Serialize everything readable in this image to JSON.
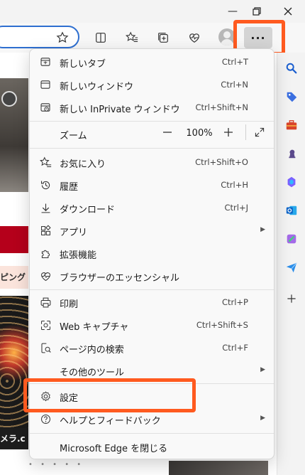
{
  "window": {
    "minimize_glyph": "—",
    "restore_glyph": "❐",
    "close_glyph": "✕"
  },
  "toolbar": {
    "more_label": "···"
  },
  "page": {
    "band_text": "ピング",
    "camera_text": "メラ.c",
    "dots": "• • • • •"
  },
  "menu": {
    "items": [
      {
        "label": "新しいタブ",
        "shortcut": "Ctrl+T",
        "icon": "new-tab-icon"
      },
      {
        "label": "新しいウィンドウ",
        "shortcut": "Ctrl+N",
        "icon": "new-window-icon"
      },
      {
        "label": "新しい InPrivate ウィンドウ",
        "shortcut": "Ctrl+Shift+N",
        "icon": "inprivate-icon"
      }
    ],
    "zoom": {
      "label": "ズーム",
      "minus": "—",
      "value": "100%",
      "plus": "+"
    },
    "items2": [
      {
        "label": "お気に入り",
        "shortcut": "Ctrl+Shift+O",
        "icon": "favorites-icon"
      },
      {
        "label": "履歴",
        "shortcut": "Ctrl+H",
        "icon": "history-icon"
      },
      {
        "label": "ダウンロード",
        "shortcut": "Ctrl+J",
        "icon": "download-icon"
      },
      {
        "label": "アプリ",
        "shortcut": "",
        "icon": "apps-icon"
      },
      {
        "label": "拡張機能",
        "shortcut": "",
        "icon": "extensions-icon"
      },
      {
        "label": "ブラウザーのエッセンシャル",
        "shortcut": "",
        "icon": "heart-pulse-icon"
      }
    ],
    "items3": [
      {
        "label": "印刷",
        "shortcut": "Ctrl+P",
        "icon": "print-icon"
      },
      {
        "label": "Web キャプチャ",
        "shortcut": "Ctrl+Shift+S",
        "icon": "web-capture-icon"
      },
      {
        "label": "ページ内の検索",
        "shortcut": "Ctrl+F",
        "icon": "find-icon"
      },
      {
        "label": "その他のツール",
        "shortcut": "",
        "icon": ""
      }
    ],
    "items4": [
      {
        "label": "設定",
        "shortcut": "",
        "icon": "settings-icon"
      },
      {
        "label": "ヘルプとフィードバック",
        "shortcut": "",
        "icon": "help-icon"
      }
    ],
    "close_label": "Microsoft Edge を閉じる"
  },
  "colors": {
    "highlight": "#ff5a1f",
    "address_border": "#2e6fd0"
  }
}
